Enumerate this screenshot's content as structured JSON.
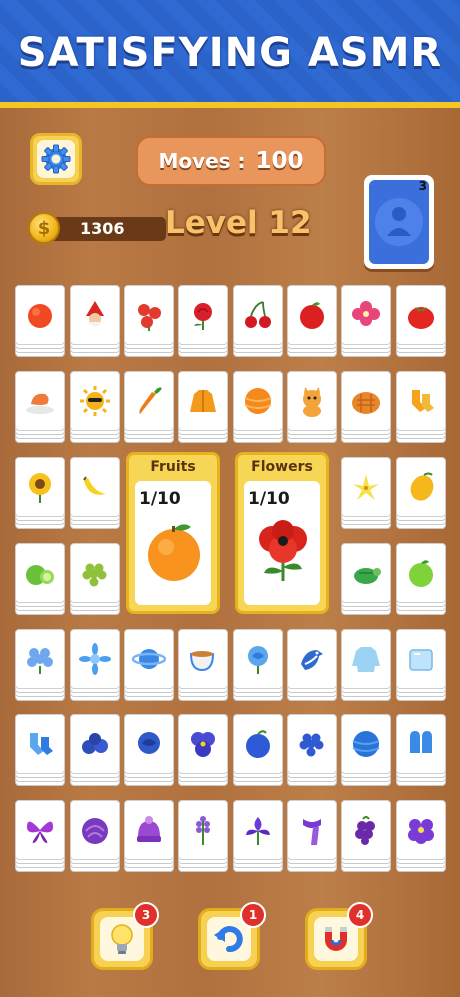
{
  "banner": {
    "title": "SATISFYING ASMR"
  },
  "hud": {
    "moves_label": "Moves :",
    "moves_value": "100",
    "coins": "1306",
    "coin_symbol": "$",
    "level": "Level 12",
    "deck_count": "3",
    "settings_icon": "gear-icon"
  },
  "categories": [
    {
      "title": "Fruits",
      "progress": "1/10",
      "icon": "orange-icon"
    },
    {
      "title": "Flowers",
      "progress": "1/10",
      "icon": "poppy-icon"
    }
  ],
  "tiles": [
    [
      "orange-icon",
      "gnome-icon",
      "red-flowers-icon",
      "red-rose-icon",
      "cherries-icon",
      "red-apple-icon",
      "orchid-icon",
      "tomato-icon"
    ],
    [
      "shrimp-icon",
      "sun-icon",
      "carrot-icon",
      "orange-jacket-icon",
      "orange-ball-icon",
      "cat-icon",
      "pie-icon",
      "orange-socks-icon"
    ],
    [
      "sunflower-icon",
      "banana-icon",
      "",
      "",
      "",
      "",
      "lily-icon",
      "mango-icon"
    ],
    [
      "lime-icon",
      "grapes-icon",
      "",
      "",
      "",
      "",
      "turtle-icon",
      "green-apple-icon"
    ],
    [
      "hydrangea-icon",
      "blue-flower-icon",
      "planet-icon",
      "teacup-icon",
      "blue-rose-icon",
      "bluejay-icon",
      "blue-sweater-icon",
      "ice-cube-icon"
    ],
    [
      "blue-socks-icon",
      "blueberries-icon",
      "dark-rose-icon",
      "pansy-icon",
      "plum-icon",
      "blue-grapes-icon",
      "blue-ball-icon",
      "mittens-icon"
    ],
    [
      "butterfly-icon",
      "cabbage-icon",
      "purple-hat-icon",
      "lavender-icon",
      "iris-icon",
      "purple-scarf-icon",
      "blackberry-icon",
      "violet-icon"
    ]
  ],
  "powerups": [
    {
      "name": "hint",
      "icon": "lightbulb-icon",
      "count": "3"
    },
    {
      "name": "undo",
      "icon": "undo-icon",
      "count": "1"
    },
    {
      "name": "magnet",
      "icon": "magnet-icon",
      "count": "4"
    }
  ],
  "colors": {
    "banner_blue": "#2f6ad2",
    "banner_gold": "#f4c623",
    "wood": "#b0713f",
    "tile": "#ffffff",
    "category_gold": "#f7d656",
    "badge_red": "#e0302a"
  }
}
